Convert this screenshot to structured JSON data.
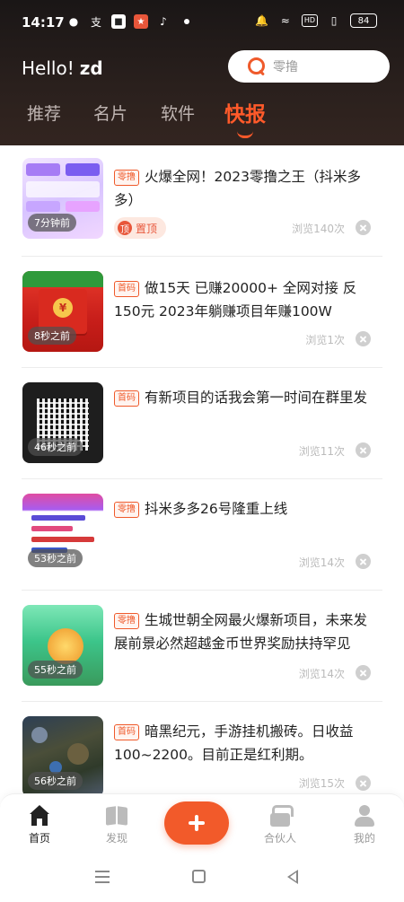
{
  "status_bar": {
    "time": "14:17",
    "battery": "84",
    "hd": "HD"
  },
  "header": {
    "greeting": "Hello!",
    "username": "zd",
    "search_placeholder": "零撸"
  },
  "tabs": [
    {
      "label": "推荐",
      "active": false
    },
    {
      "label": "名片",
      "active": false
    },
    {
      "label": "软件",
      "active": false
    },
    {
      "label": "快报",
      "active": true
    }
  ],
  "feed": {
    "items": [
      {
        "tag": "零撸",
        "title": "火爆全网！2023零撸之王（抖米多多）",
        "time": "7分钟前",
        "views": "浏览140次",
        "pinned": true,
        "pin_badge": "顶",
        "pin_label": "置顶"
      },
      {
        "tag": "首码",
        "title": "做15天 已赚20000+ 全网对接 反150元 2023年躺赚项目年赚100W",
        "time": "8秒之前",
        "views": "浏览1次",
        "pinned": false
      },
      {
        "tag": "首码",
        "title": "有新项目的话我会第一时间在群里发",
        "time": "46秒之前",
        "views": "浏览11次",
        "pinned": false
      },
      {
        "tag": "零撸",
        "title": "抖米多多26号隆重上线",
        "time": "53秒之前",
        "views": "浏览14次",
        "pinned": false
      },
      {
        "tag": "零撸",
        "title": "生城世朝全网最火爆新项目，未来发展前景必然超越金币世界奖励扶持罕见",
        "time": "55秒之前",
        "views": "浏览14次",
        "pinned": false
      },
      {
        "tag": "首码",
        "title": "暗黑纪元，手游挂机搬砖。日收益100~2200。目前正是红利期。",
        "time": "56秒之前",
        "views": "浏览15次",
        "pinned": false
      }
    ]
  },
  "bottom_nav": {
    "items": [
      {
        "label": "首页",
        "icon": "home-icon",
        "active": true
      },
      {
        "label": "发现",
        "icon": "book-icon",
        "active": false
      },
      {
        "label": "合伙人",
        "icon": "partner-icon",
        "active": false
      },
      {
        "label": "我的",
        "icon": "user-icon",
        "active": false
      }
    ]
  },
  "colors": {
    "accent": "#f25a2a",
    "header_bg": "#1a1616",
    "tag": "#ef5a2b"
  }
}
